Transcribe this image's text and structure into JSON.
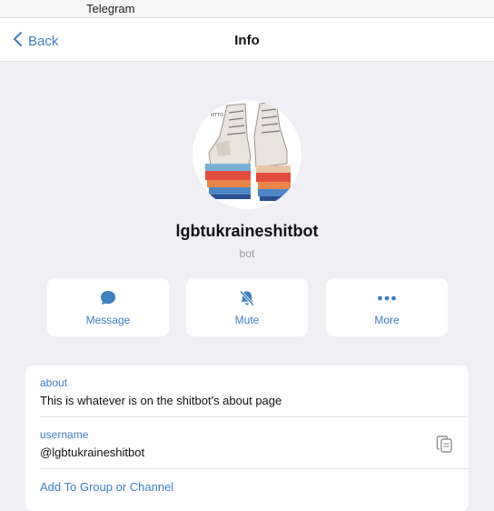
{
  "window": {
    "title": "Telegram"
  },
  "navbar": {
    "back_label": "Back",
    "title": "Info"
  },
  "profile": {
    "name": "lgbtukraineshitbot",
    "subtitle": "bot"
  },
  "actions": [
    {
      "label": "Message",
      "icon": "message-bubble-icon"
    },
    {
      "label": "Mute",
      "icon": "bell-slash-icon"
    },
    {
      "label": "More",
      "icon": "ellipsis-icon"
    }
  ],
  "info": {
    "about_label": "about",
    "about_value": "This is whatever is on the shitbot's about page",
    "username_label": "username",
    "username_value": "@lgbtukraineshitbot",
    "add_to_group": "Add To Group or Channel"
  },
  "colors": {
    "accent": "#3d7fbf",
    "background": "#efeff4",
    "card": "#ffffff"
  }
}
